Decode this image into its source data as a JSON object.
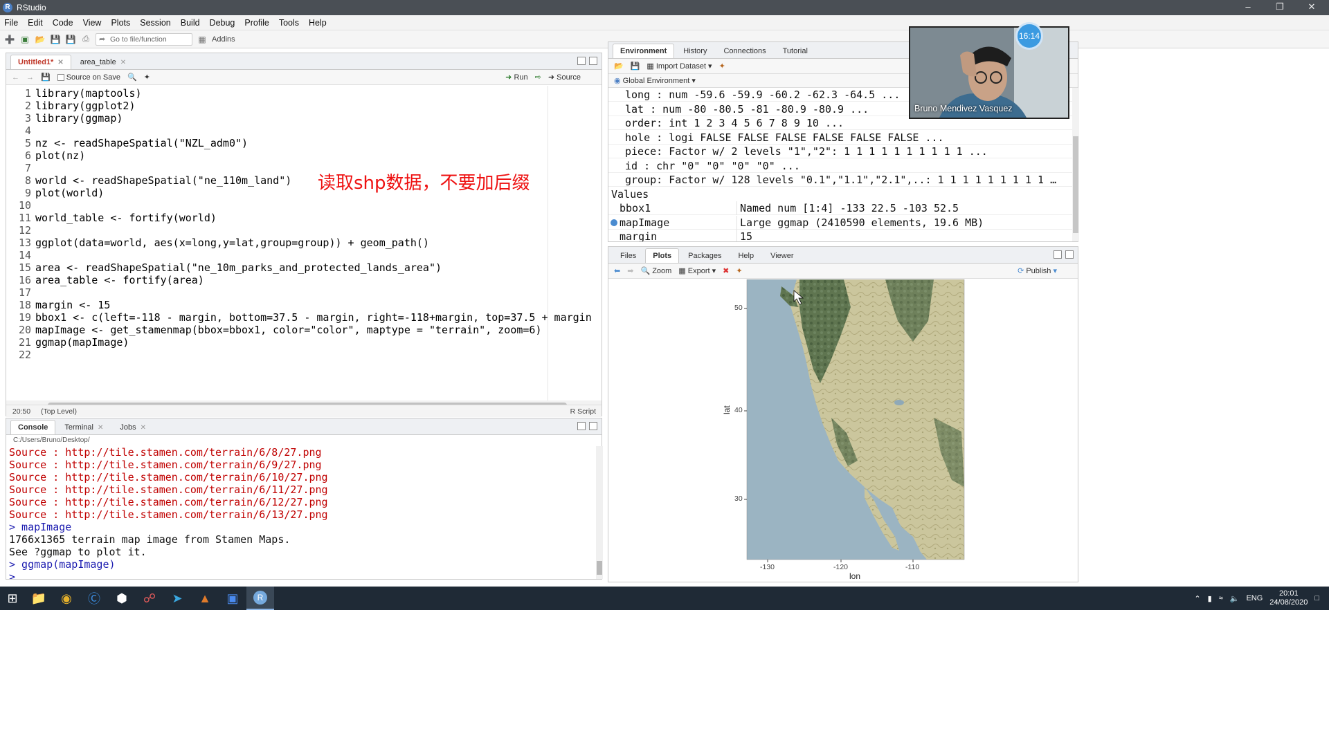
{
  "window": {
    "title": "RStudio"
  },
  "menu": [
    "File",
    "Edit",
    "Code",
    "View",
    "Plots",
    "Session",
    "Build",
    "Debug",
    "Profile",
    "Tools",
    "Help"
  ],
  "toolbar": {
    "goto_placeholder": "Go to file/function",
    "addins": "Addins"
  },
  "editor": {
    "tabs": [
      {
        "label": "Untitled1*"
      },
      {
        "label": "area_table"
      }
    ],
    "source_on_save": "Source on Save",
    "run_label": "Run",
    "source_label": "Source",
    "lines": [
      "library(maptools)",
      "library(ggplot2)",
      "library(ggmap)",
      "",
      "nz <- readShapeSpatial(\"NZL_adm0\")",
      "plot(nz)",
      "",
      "world <- readShapeSpatial(\"ne_110m_land\")",
      "plot(world)",
      "",
      "world_table <- fortify(world)",
      "",
      "ggplot(data=world, aes(x=long,y=lat,group=group)) + geom_path()",
      "",
      "area <- readShapeSpatial(\"ne_10m_parks_and_protected_lands_area\")",
      "area_table <- fortify(area)",
      "",
      "margin <- 15",
      "bbox1 <- c(left=-118 - margin, bottom=37.5 - margin, right=-118+margin, top=37.5 + margin",
      "mapImage <- get_stamenmap(bbox=bbox1, color=\"color\", maptype = \"terrain\", zoom=6)",
      "ggmap(mapImage)",
      ""
    ],
    "overlay_note": "读取shp数据，不要加后缀",
    "status": {
      "position": "20:50",
      "scope": "(Top Level)",
      "filetype": "R Script"
    }
  },
  "console": {
    "tabs": [
      {
        "label": "Console"
      },
      {
        "label": "Terminal"
      },
      {
        "label": "Jobs"
      }
    ],
    "path": "C:/Users/Bruno/Desktop/",
    "lines": [
      {
        "text": "Source : http://tile.stamen.com/terrain/6/8/27.png",
        "color": "red"
      },
      {
        "text": "Source : http://tile.stamen.com/terrain/6/9/27.png",
        "color": "red"
      },
      {
        "text": "Source : http://tile.stamen.com/terrain/6/10/27.png",
        "color": "red"
      },
      {
        "text": "Source : http://tile.stamen.com/terrain/6/11/27.png",
        "color": "red"
      },
      {
        "text": "Source : http://tile.stamen.com/terrain/6/12/27.png",
        "color": "red"
      },
      {
        "text": "Source : http://tile.stamen.com/terrain/6/13/27.png",
        "color": "red"
      },
      {
        "text": "> mapImage",
        "color": "blue"
      },
      {
        "text": "1766x1365 terrain map image from Stamen Maps.",
        "color": "black"
      },
      {
        "text": "See ?ggmap to plot it.",
        "color": "black"
      },
      {
        "text": "> ggmap(mapImage)",
        "color": "blue"
      },
      {
        "text": "> ",
        "color": "blue"
      }
    ]
  },
  "environment": {
    "tabs": [
      {
        "label": "Environment"
      },
      {
        "label": "History"
      },
      {
        "label": "Connections"
      },
      {
        "label": "Tutorial"
      }
    ],
    "import_dataset": "Import Dataset",
    "scope": "Global Environment",
    "data_lines": [
      "long : num -59.6 -59.9 -60.2 -62.3 -64.5 ...",
      "lat : num -80 -80.5 -81 -80.9 -80.9 ...",
      "order: int 1 2 3 4 5 6 7 8 9 10 ...",
      "hole : logi FALSE FALSE FALSE FALSE FALSE FALSE ...",
      "piece: Factor w/ 2 levels \"1\",\"2\": 1 1 1 1 1 1 1 1 1 1 ...",
      "id : chr \"0\" \"0\" \"0\" \"0\" ...",
      "group: Factor w/ 128 levels \"0.1\",\"1.1\",\"2.1\",..: 1 1 1 1 1 1 1 1 1 …"
    ],
    "values_header": "Values",
    "values": [
      {
        "name": "bbox1",
        "value": "Named num [1:4] -133 22.5 -103 52.5"
      },
      {
        "name": "mapImage",
        "value": "Large ggmap (2410590 elements, 19.6 MB)"
      },
      {
        "name": "margin",
        "value": "15"
      }
    ]
  },
  "plots": {
    "tabs": [
      {
        "label": "Files"
      },
      {
        "label": "Plots"
      },
      {
        "label": "Packages"
      },
      {
        "label": "Help"
      },
      {
        "label": "Viewer"
      }
    ],
    "zoom": "Zoom",
    "export": "Export",
    "publish": "Publish",
    "y_ticks": [
      "50",
      "40",
      "30"
    ],
    "x_ticks": [
      "-130",
      "-120",
      "-110"
    ],
    "xlabel": "lon",
    "ylabel": "lat",
    "colors": {
      "ocean": "#9bb4c2",
      "land": "#c9c59a",
      "forest": "#5b7049"
    }
  },
  "webcam": {
    "name": "Bruno Mendivez Vasquez",
    "timer": "16:14"
  },
  "taskbar": {
    "lang": "ENG",
    "time": "20:01",
    "date": "24/08/2020"
  }
}
